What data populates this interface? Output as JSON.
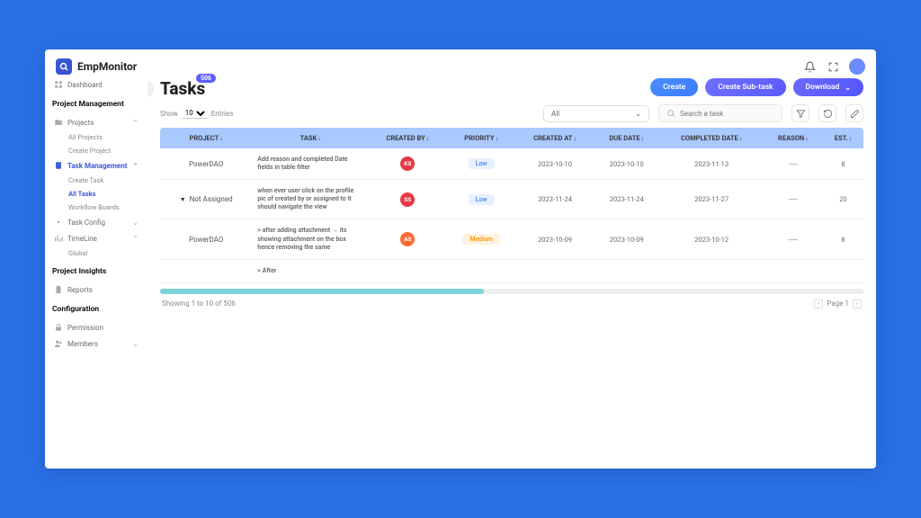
{
  "brand": "EmpMonitor",
  "topbar": {
    "avatar": ""
  },
  "sidebar": {
    "dashboard": "Dashboard",
    "section_pm": "Project Management",
    "projects": "Projects",
    "projects_sub": [
      "All Projects",
      "Create Project"
    ],
    "task_mgmt": "Task Management",
    "task_mgmt_sub": [
      "Create Task",
      "All Tasks",
      "Workflow Boards"
    ],
    "task_mgmt_active": "All Tasks",
    "task_config": "Task Config",
    "timeline": "TimeLine",
    "timeline_sub": [
      "Global"
    ],
    "section_pi": "Project Insights",
    "reports": "Reports",
    "section_cfg": "Configuration",
    "permission": "Permission",
    "members": "Members"
  },
  "header": {
    "title": "Tasks",
    "badge": "506",
    "create": "Create",
    "create_sub": "Create Sub-task",
    "download": "Download"
  },
  "controls": {
    "show": "Show",
    "perpage": "10",
    "entries": "Entries",
    "filter_all": "All",
    "search_placeholder": "Search a task"
  },
  "columns": [
    "PROJECT",
    "TASK",
    "CREATED BY",
    "PRIORITY",
    "CREATED AT",
    "DUE DATE",
    "COMPLETED DATE",
    "REASON",
    "EST."
  ],
  "rows": [
    {
      "project": "PowerDAO",
      "task": "Add reason and completed Date fields in table filter",
      "avatar": "KS",
      "avatarClass": "ks",
      "priority": "Low",
      "prioClass": "prio-low",
      "created": "2023-10-10",
      "due": "2023-10-10",
      "completed": "2023-11-13",
      "reason": "-----",
      "est": "8",
      "expand": false
    },
    {
      "project": "Not Assigned",
      "task": "when ever user click on the profile pic of created by or assigned to it should navigate the view",
      "avatar": "SS",
      "avatarClass": "ss",
      "priority": "Low",
      "prioClass": "prio-low",
      "created": "2023-11-24",
      "due": "2023-11-24",
      "completed": "2023-11-27",
      "reason": "-----",
      "est": "20",
      "expand": true
    },
    {
      "project": "PowerDAO",
      "task": "> after adding attachment → its showing attachment on the box hence removing the same",
      "avatar": "AS",
      "avatarClass": "as",
      "priority": "Medium",
      "prioClass": "prio-medium",
      "created": "2023-10-09",
      "due": "2023-10-09",
      "completed": "2023-10-12",
      "reason": "-----",
      "est": "8",
      "expand": false
    },
    {
      "project": "",
      "task": "> After",
      "avatar": "",
      "avatarClass": "",
      "priority": "",
      "prioClass": "",
      "created": "",
      "due": "",
      "completed": "",
      "reason": "",
      "est": "",
      "expand": false
    }
  ],
  "footer": {
    "showing": "Showing 1 to 10 of 506",
    "page_label": "Page 1"
  }
}
